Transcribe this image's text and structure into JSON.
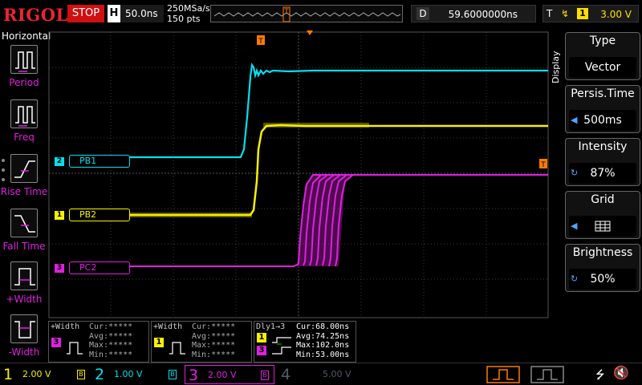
{
  "topbar": {
    "logo": "RIGOL",
    "run_state": "STOP",
    "h_label": "H",
    "timebase": "50.0ns",
    "sample_rate": "250MSa/s",
    "points": "150 pts",
    "delay_label": "D",
    "delay_value": "59.6000000ns",
    "trigger_label": "T",
    "trigger_source": "1",
    "trigger_level": "3.00 V"
  },
  "left_menu": {
    "title": "Horizontal",
    "items": [
      {
        "label": "Period"
      },
      {
        "label": "Freq"
      },
      {
        "label": "Rise Time"
      },
      {
        "label": "Fall Time"
      },
      {
        "label": "+Width"
      },
      {
        "label": "-Width"
      }
    ]
  },
  "right_panel": {
    "section": "Display",
    "items": [
      {
        "label": "Type",
        "value": "Vector"
      },
      {
        "label": "Persis.Time",
        "value": "500ms"
      },
      {
        "label": "Intensity",
        "value": "87%"
      },
      {
        "label": "Grid",
        "value": "grid-icon"
      },
      {
        "label": "Brightness",
        "value": "50%"
      }
    ]
  },
  "traces": {
    "labels": [
      {
        "ch": "2",
        "name": "PB1",
        "color": "#00e0f0"
      },
      {
        "ch": "1",
        "name": "PB2",
        "color": "#f8f000"
      },
      {
        "ch": "3",
        "name": "PC2",
        "color": "#e020e0"
      }
    ]
  },
  "measurements": [
    {
      "title": "+Width",
      "ch": "3",
      "color": "#e020e0",
      "rows": [
        "Cur:*****",
        "Avg:*****",
        "Max:*****",
        "Min:*****"
      ]
    },
    {
      "title": "+Width",
      "ch": "1",
      "color": "#f8f000",
      "rows": [
        "Cur:*****",
        "Avg:*****",
        "Max:*****",
        "Min:*****"
      ]
    },
    {
      "title": "Dly1→3",
      "ch": "1",
      "ch2": "3",
      "rows": [
        "Cur:68.00ns",
        "Avg:74.25ns",
        "Max:102.0ns",
        "Min:53.00ns"
      ]
    }
  ],
  "channels": [
    {
      "num": "1",
      "scale": "2.00 V",
      "color": "#f8f000"
    },
    {
      "num": "2",
      "scale": "1.00 V",
      "color": "#00e0f0"
    },
    {
      "num": "3",
      "scale": "2.00 V",
      "color": "#e020e0"
    },
    {
      "num": "4",
      "scale": "5.00 V",
      "color": "#555a6a"
    }
  ],
  "colors": {
    "ch1": "#f8f000",
    "ch2": "#00e0f0",
    "ch3": "#e020e0",
    "ch4": "#555a6a",
    "grid": "#3a3a3a",
    "trigger": "#ff7a00",
    "stop": "#d01010"
  }
}
